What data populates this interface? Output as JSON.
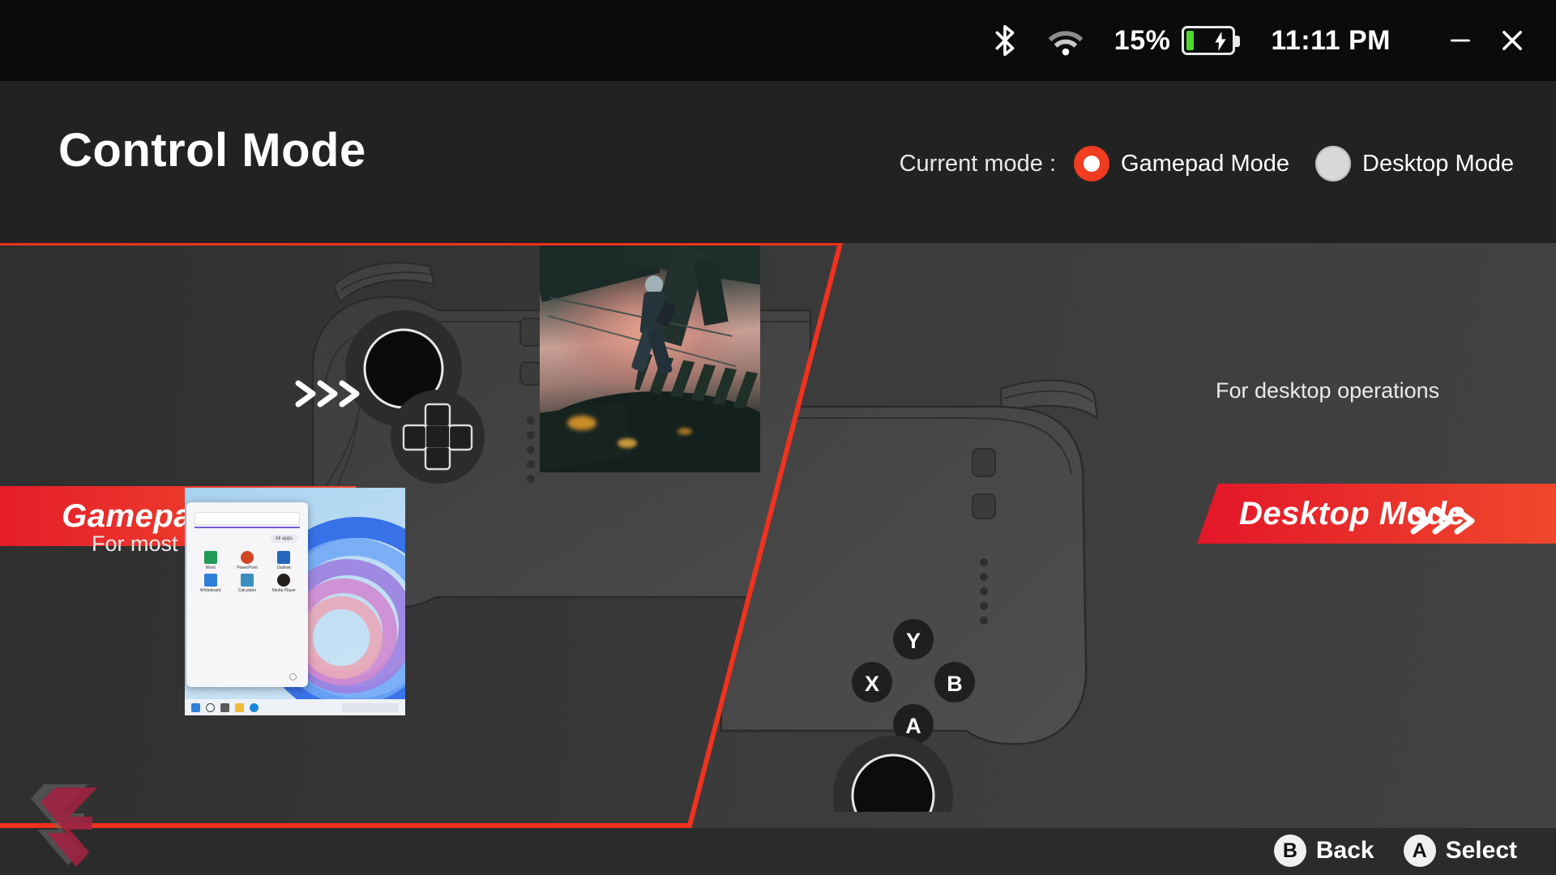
{
  "statusbar": {
    "bluetooth_icon": "bluetooth-icon",
    "wifi_icon": "wifi-icon",
    "battery_percent": "15%",
    "battery_level": 15,
    "battery_charging": true,
    "clock": "11:11 PM",
    "minimize_label": "Minimize",
    "close_label": "Close"
  },
  "header": {
    "title": "Control Mode",
    "current_mode_label": "Current mode :",
    "options": [
      {
        "label": "Gamepad Mode",
        "selected": true
      },
      {
        "label": "Desktop Mode",
        "selected": false
      }
    ]
  },
  "panels": {
    "gamepad": {
      "banner": "Gamepad Mode",
      "caption": "For most of the games",
      "chevrons": ">>>",
      "selected": true,
      "screen_content": "game-screenshot"
    },
    "desktop": {
      "banner": "Desktop Mode",
      "caption": "For desktop operations",
      "chevrons": ">>>",
      "selected": false,
      "screen_content": "windows-desktop-screenshot",
      "start_menu": {
        "all_apps_label": "All apps",
        "apps": [
          "Word",
          "PowerPoint",
          "Outlook",
          "Whiteboard",
          "Calculator",
          "Media Player"
        ]
      }
    },
    "device_buttons": [
      "Y",
      "X",
      "B",
      "A"
    ]
  },
  "bottombar": {
    "hints": [
      {
        "key": "B",
        "label": "Back"
      },
      {
        "key": "A",
        "label": "Select"
      }
    ]
  },
  "colors": {
    "accent_red": "#f03c20",
    "banner_from": "#e3162a",
    "banner_to": "#f1512c",
    "battery_green": "#4cd92e",
    "header_bg": "#222222",
    "statusbar_bg": "#0b0b0b",
    "bottombar_bg": "#2b2b2b"
  }
}
